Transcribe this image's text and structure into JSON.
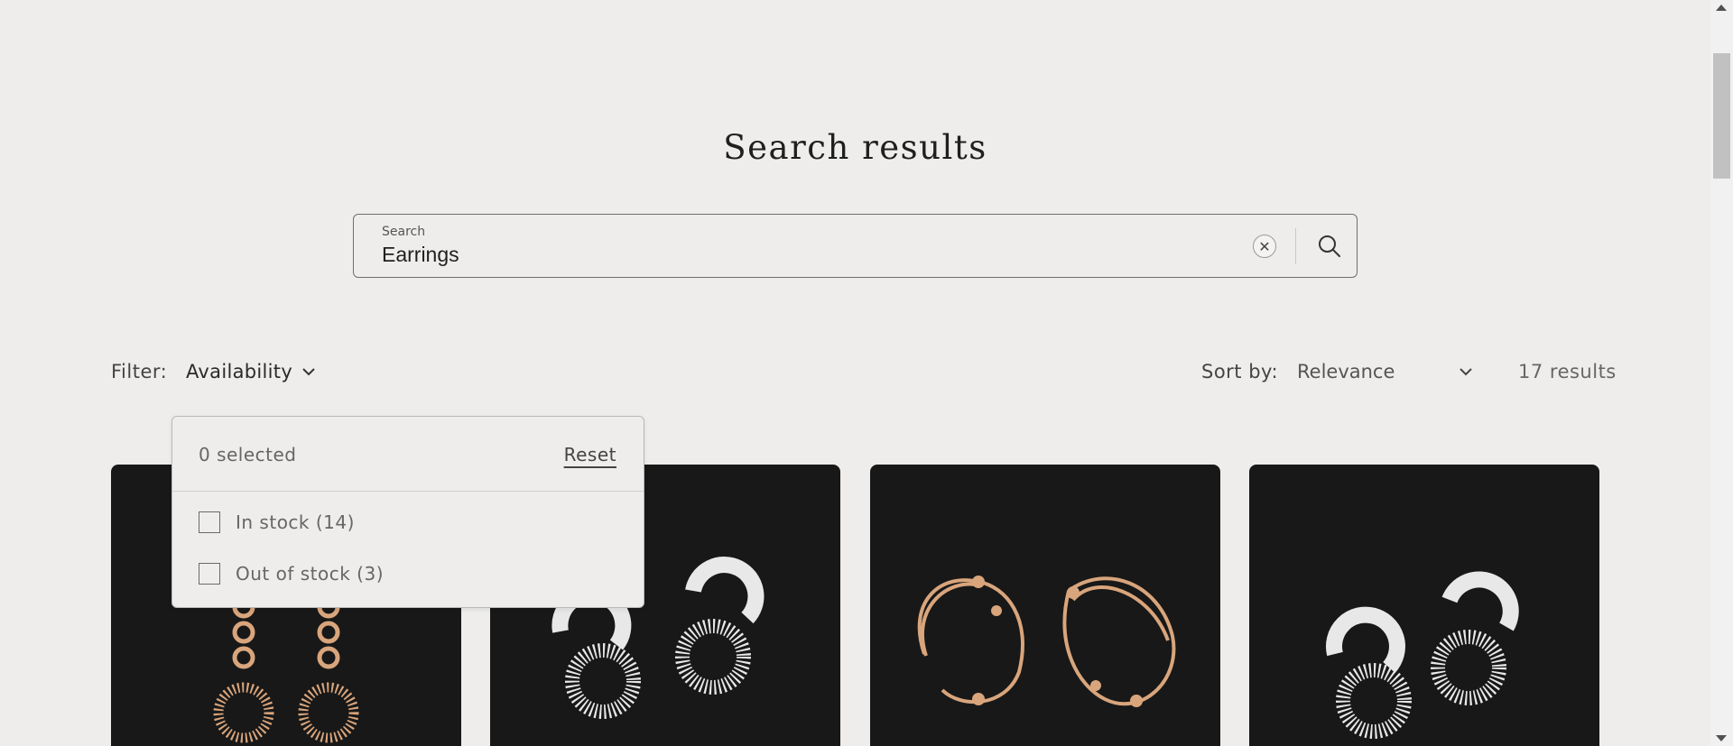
{
  "page": {
    "title": "Search results"
  },
  "search": {
    "label": "Search",
    "value": "Earrings",
    "clear_icon": "close-circle-icon",
    "submit_icon": "search-icon"
  },
  "filter": {
    "label": "Filter:",
    "availability_label": "Availability",
    "dropdown": {
      "selected_text": "0 selected",
      "reset_label": "Reset",
      "options": [
        {
          "label": "In stock (14)",
          "checked": false
        },
        {
          "label": "Out of stock (3)",
          "checked": false
        }
      ]
    }
  },
  "sort": {
    "label": "Sort by:",
    "selected": "Relevance"
  },
  "results": {
    "count_text": "17 results"
  },
  "products": [
    {
      "image": "rose-gold-chain-drop-earrings"
    },
    {
      "image": "white-gold-diamond-interlocking-earrings"
    },
    {
      "image": "rose-gold-twisted-hoop-earrings"
    },
    {
      "image": "white-gold-diamond-interlocking-earrings"
    }
  ],
  "colors": {
    "background": "#eeedeb",
    "card_background": "#181818",
    "rose_gold": "#d9a57c",
    "white_gold": "#e8e8e8"
  }
}
